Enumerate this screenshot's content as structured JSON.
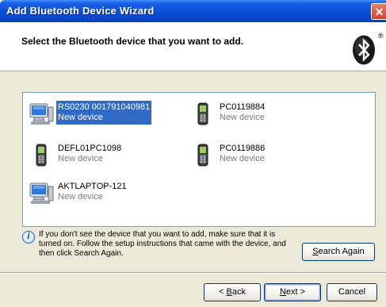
{
  "window": {
    "title": "Add Bluetooth Device Wizard"
  },
  "header": {
    "text": "Select the Bluetooth device that you want to add.",
    "logo": "bluetooth-logo",
    "registered_mark": "®"
  },
  "devices": [
    {
      "name": "RS0230 001791040981",
      "status": "New device",
      "icon": "computer-icon",
      "selected": true
    },
    {
      "name": "PC0119884",
      "status": "New device",
      "icon": "mobile-phone-icon",
      "selected": false
    },
    {
      "name": "DEFL01PC1098",
      "status": "New device",
      "icon": "mobile-phone-icon",
      "selected": false
    },
    {
      "name": "PC0119886",
      "status": "New device",
      "icon": "mobile-phone-icon",
      "selected": false
    },
    {
      "name": "AKTLAPTOP-121",
      "status": "New device",
      "icon": "computer-icon",
      "selected": false
    }
  ],
  "info": {
    "icon": "info-icon",
    "text": "If you don't see the device that you want to add, make sure that it is turned on. Follow the setup instructions that came with the device, and then click Search Again."
  },
  "buttons": {
    "search_again": {
      "accel": "S",
      "rest": "earch Again"
    },
    "back": {
      "prefix": "< ",
      "accel": "B",
      "rest": "ack"
    },
    "next": {
      "accel": "N",
      "rest": "ext >"
    },
    "cancel": "Cancel"
  },
  "colors": {
    "selection": "#316ac5",
    "titlebar": "#0a4fd8",
    "dialog_bg": "#ece9d8"
  }
}
